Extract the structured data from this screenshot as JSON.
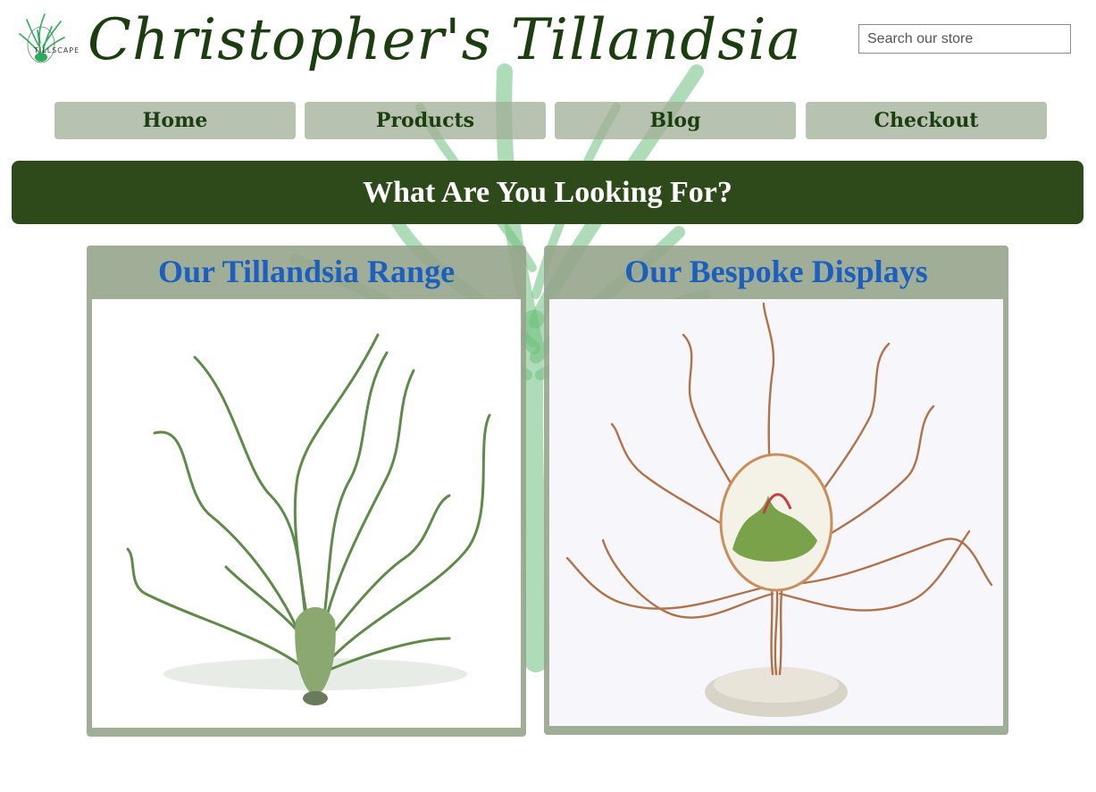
{
  "header": {
    "logo_text": "TILLSCAPE",
    "site_title": "Christopher's Tillandsia",
    "search_placeholder": "Search our store"
  },
  "nav": {
    "items": [
      {
        "label": "Home"
      },
      {
        "label": "Products"
      },
      {
        "label": "Blog"
      },
      {
        "label": "Checkout"
      }
    ]
  },
  "banner": {
    "text": "What Are You Looking For?"
  },
  "cards": [
    {
      "title": "Our Tillandsia Range",
      "image": "tillandsia-plant-photo"
    },
    {
      "title": "Our Bespoke Displays",
      "image": "copper-wire-tree-display-photo"
    }
  ],
  "colors": {
    "title_green": "#1c3d10",
    "banner_green": "#2e4a1a",
    "nav_sage": "#a0ae96",
    "card_title_blue": "#1d5fbf"
  }
}
